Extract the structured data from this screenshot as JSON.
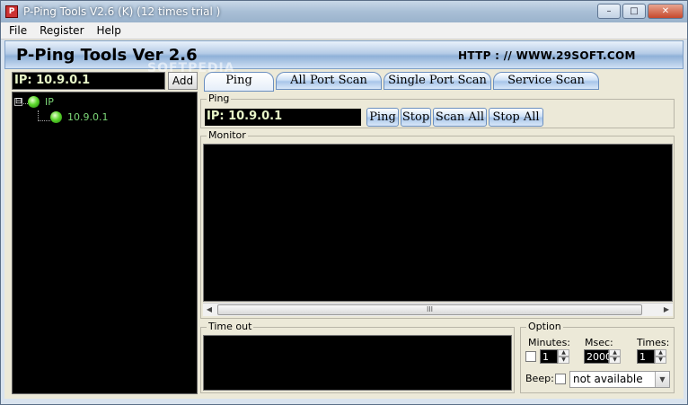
{
  "window": {
    "title": "P-Ping Tools V2.6 (K)   (12 times trial )",
    "controls": {
      "minimize": "–",
      "maximize": "□",
      "close": "✕"
    }
  },
  "menu": [
    "File",
    "Register",
    "Help"
  ],
  "banner": {
    "title": "P-Ping Tools Ver 2.6",
    "url": "HTTP : // WWW.29SOFT.COM",
    "watermark": "SOFTPEDIA"
  },
  "left": {
    "ip_input": "IP: 10.9.0.1",
    "add_label": "Add",
    "tree": {
      "root": {
        "label": "IP",
        "expander": "⊟"
      },
      "child": {
        "label": "10.9.0.1"
      }
    }
  },
  "tabs": [
    {
      "label": "Ping",
      "active": true
    },
    {
      "label": "All Port Scan",
      "active": false
    },
    {
      "label": "Single Port Scan",
      "active": false
    },
    {
      "label": "Service Scan",
      "active": false
    }
  ],
  "ping": {
    "group_label": "Ping",
    "ip_display": "IP: 10.9.0.1",
    "buttons": [
      "Ping",
      "Stop",
      "Scan All",
      "Stop All"
    ]
  },
  "monitor": {
    "group_label": "Monitor",
    "scroll_left": "◀",
    "scroll_right": "▶",
    "thumb_grip": "III"
  },
  "timeout": {
    "group_label": "Time out"
  },
  "option": {
    "group_label": "Option",
    "minutes_label": "Minutes:",
    "minutes_value": "1",
    "msec_label": "Msec:",
    "msec_value": "2000",
    "times_label": "Times:",
    "times_value": "1",
    "beep_label": "Beep:",
    "beep_select": "not available",
    "spin_up": "▲",
    "spin_down": "▼",
    "select_arrow": "▼"
  }
}
